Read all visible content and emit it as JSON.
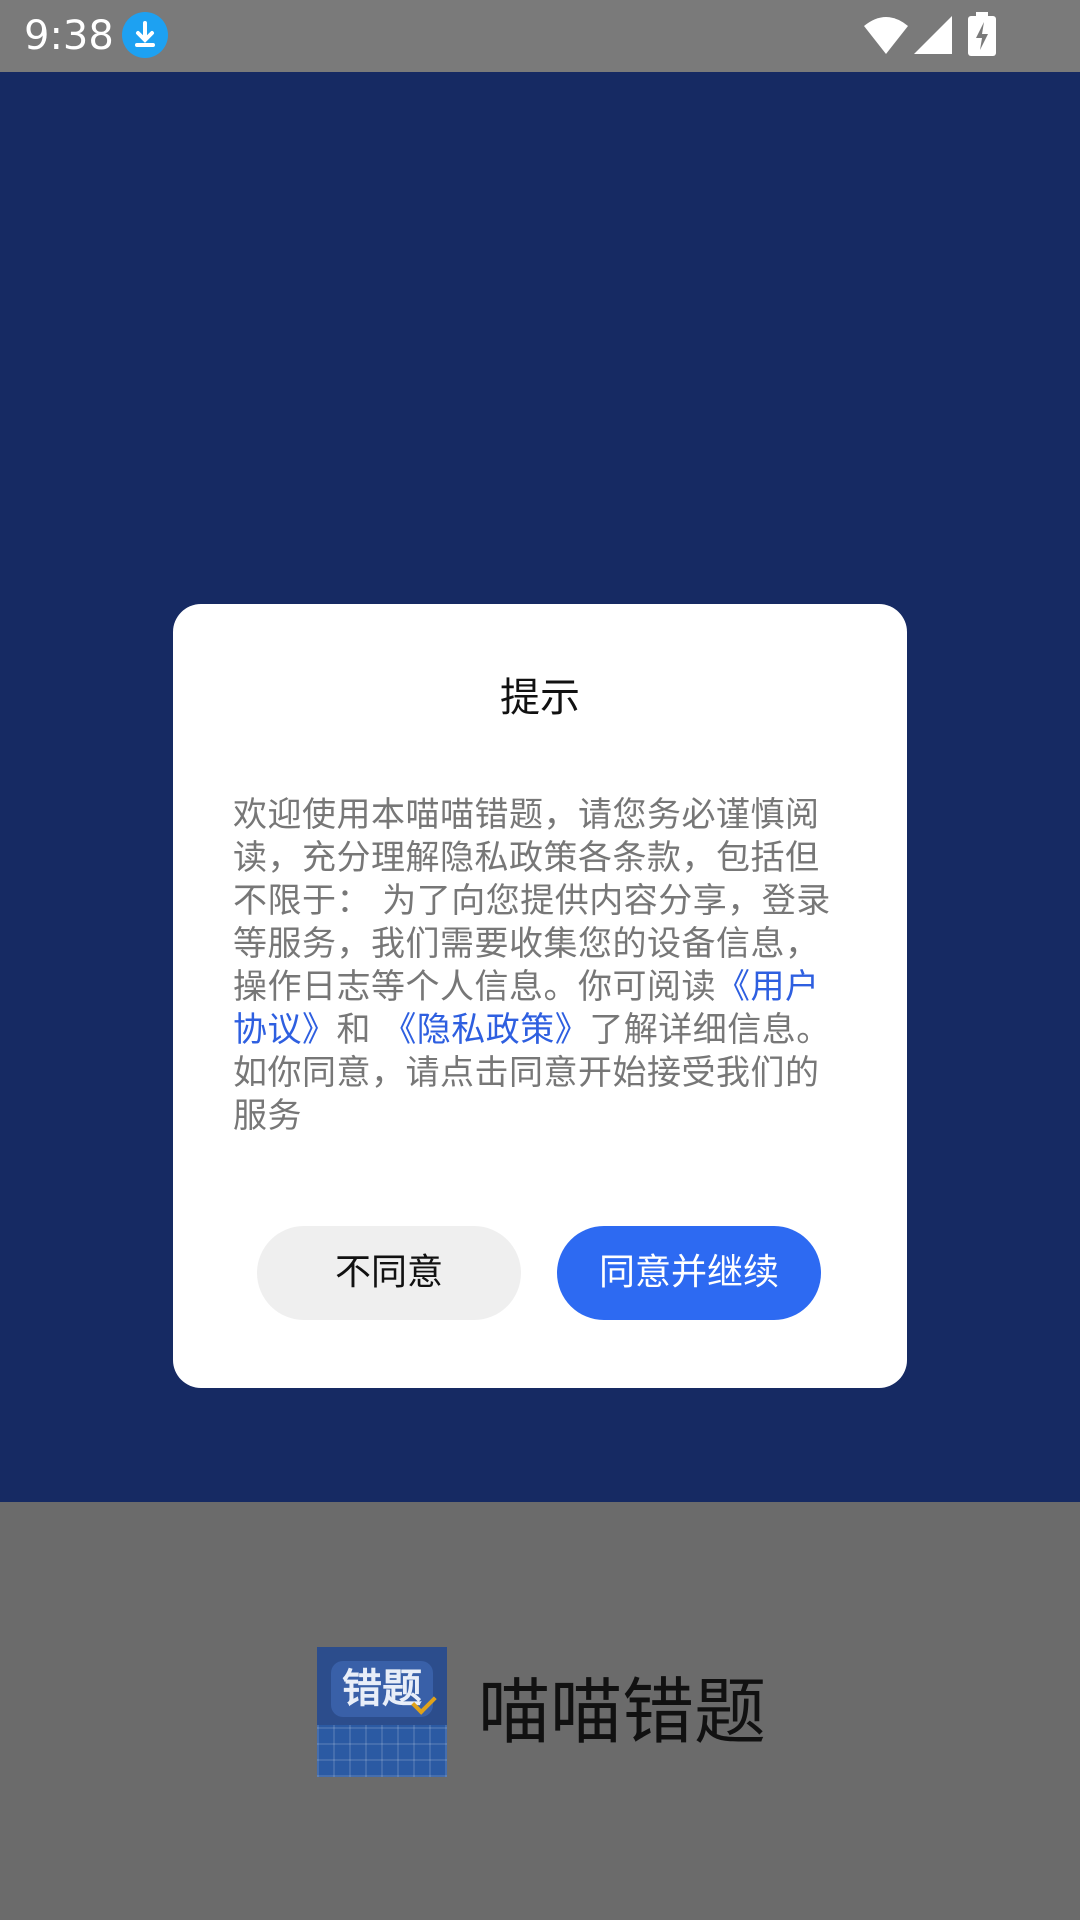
{
  "status_bar": {
    "time": "9:38",
    "icons": [
      "download-icon",
      "wifi-icon",
      "signal-icon",
      "battery-charging-icon"
    ]
  },
  "colors": {
    "background_blue": "#162a63",
    "accent_blue": "#2d6af2",
    "link_blue": "#2e5fe0",
    "overlay_grey": "#6b6b6b"
  },
  "dialog": {
    "title": "提示",
    "body_part1": "欢迎使用本喵喵错题，请您务必谨慎阅读，充分理解隐私政策各条款，包括但不限于： 为了向您提供内容分享，登录等服务，我们需要收集您的设备信息，操作日志等个人信息。你可阅读",
    "user_agreement_link": "《用户协议》",
    "and_text": "和 ",
    "privacy_policy_link": "《隐私政策》",
    "body_part2": "了解详细信息。如你同意，请点击同意开始接受我们的服务",
    "disagree_label": "不同意",
    "agree_label": "同意并继续"
  },
  "brand": {
    "logo_text": "错题",
    "app_name": "喵喵错题"
  }
}
